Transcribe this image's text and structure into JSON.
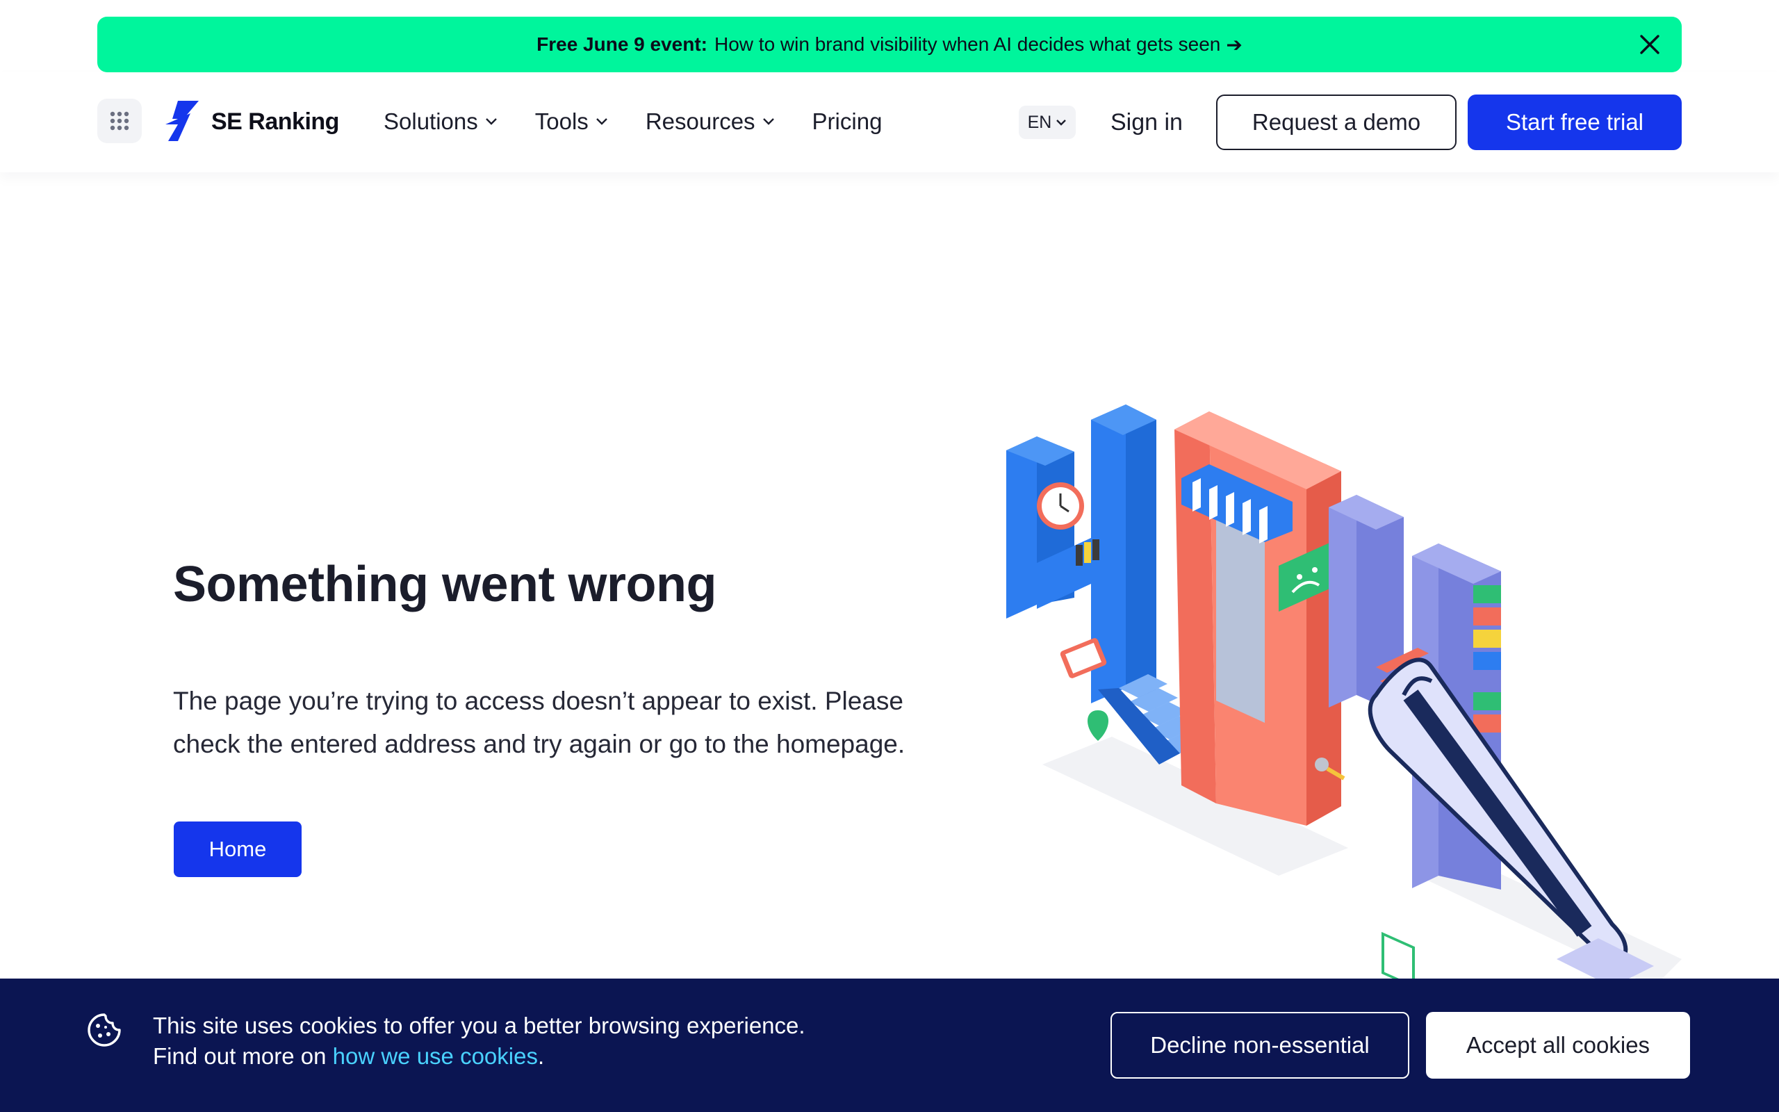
{
  "promo": {
    "bold": "Free June 9 event:",
    "text": "How to win brand visibility when AI decides what gets seen",
    "arrow": "➔",
    "close_icon": "close-icon"
  },
  "header": {
    "logo_text": "SE Ranking",
    "nav": [
      {
        "label": "Solutions",
        "has_dropdown": true
      },
      {
        "label": "Tools",
        "has_dropdown": true
      },
      {
        "label": "Resources",
        "has_dropdown": true
      },
      {
        "label": "Pricing",
        "has_dropdown": false
      }
    ],
    "lang": "EN",
    "sign_in": "Sign in",
    "request_demo": "Request a demo",
    "start_trial": "Start free trial"
  },
  "main": {
    "title": "Something went wrong",
    "description": "The page you’re trying to access doesn’t appear to exist. Please check the entered address and try again or go to the homepage.",
    "home_button": "Home"
  },
  "cookie": {
    "line1": "This site uses cookies to offer you a better browsing experience.",
    "line2_prefix": "Find out more on ",
    "link": "how we use cookies",
    "line2_suffix": ".",
    "decline": "Decline non-essential",
    "accept": "Accept all cookies"
  },
  "colors": {
    "promo_bg": "#00f59c",
    "brand_blue": "#1536ec",
    "cookie_bg": "#0b1552",
    "cookie_link": "#4ad2ff"
  }
}
